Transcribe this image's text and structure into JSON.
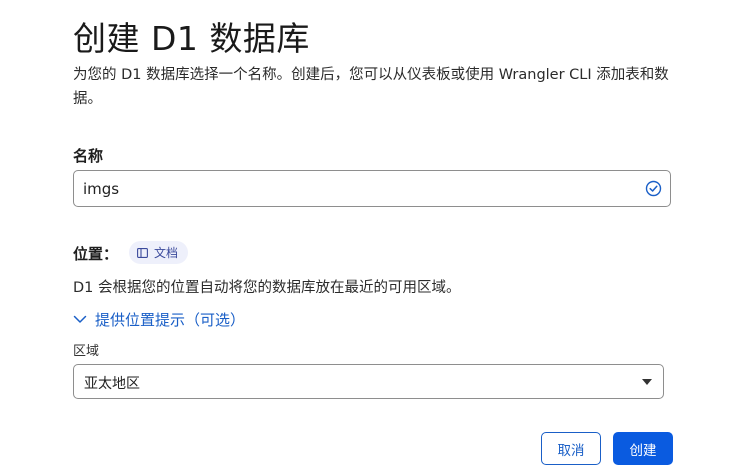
{
  "header": {
    "title": "创建 D1 数据库",
    "description": "为您的 D1 数据库选择一个名称。创建后，您可以从仪表板或使用 Wrangler CLI 添加表和数据。"
  },
  "name_field": {
    "label": "名称",
    "value": "imgs",
    "status_icon": "check-circle-icon"
  },
  "location": {
    "label": "位置：",
    "docs_badge": "文档",
    "docs_icon": "book-icon",
    "description": "D1 会根据您的位置自动将您的数据库放在最近的可用区域。",
    "hint_toggle": "提供位置提示（可选）"
  },
  "region": {
    "label": "区域",
    "selected": "亚太地区"
  },
  "actions": {
    "cancel_label": "取消",
    "create_label": "创建"
  },
  "colors": {
    "accent": "#0a5be0",
    "link": "#1a5fc7",
    "badge_bg": "#eef0fb"
  }
}
